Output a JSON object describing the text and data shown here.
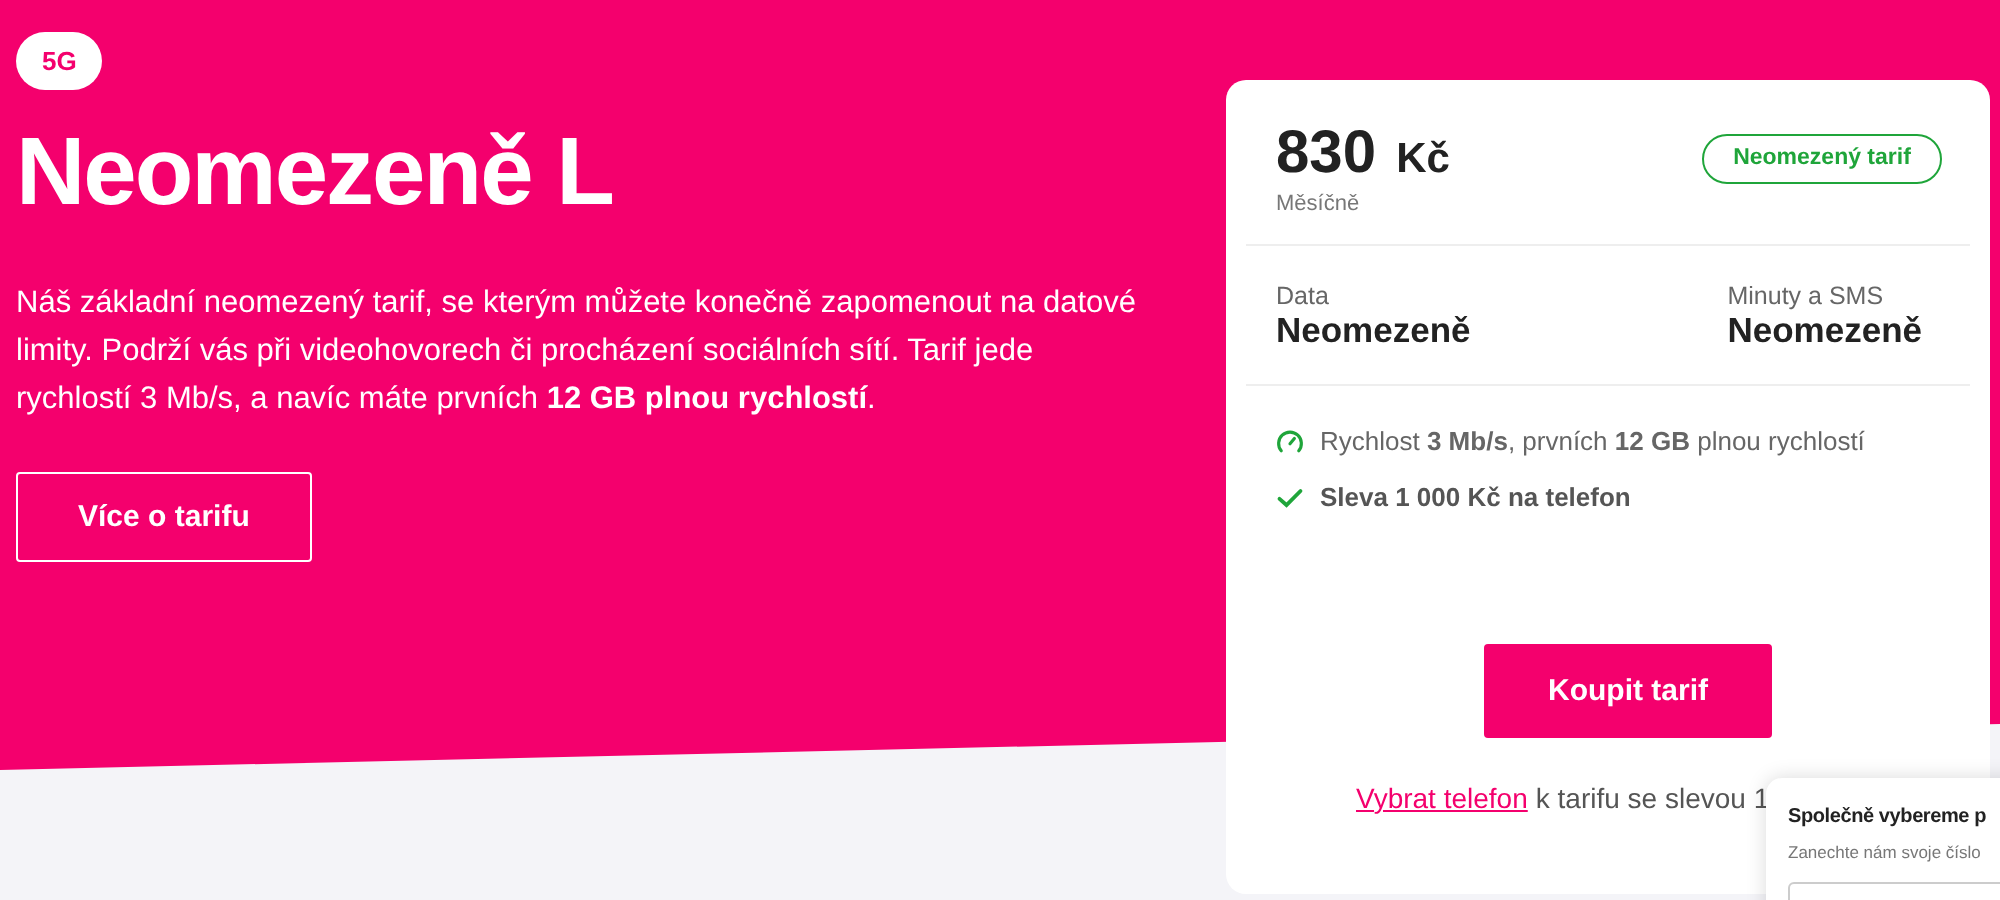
{
  "hero": {
    "badge": "5G",
    "title": "Neomezeně L",
    "description": "Náš základní neomezený tarif, se kterým můžete konečně zapomenout na datové limity. Podrží vás při videohovorech či procházení sociálních sítí. Tarif jede rychlostí 3 Mb/s, a navíc máte prvních **12 GB plnou rychlostí**.",
    "button": "Více o tarifu"
  },
  "card": {
    "price": "830",
    "currency": "Kč",
    "period": "Měsíčně",
    "tag": "Neomezený tarif",
    "specs": [
      {
        "label": "Data",
        "value": "Neomezeně"
      },
      {
        "label": "Minuty a SMS",
        "value": "Neomezeně"
      }
    ],
    "features": [
      {
        "kind": "speed",
        "text": "Rychlost **3 Mb/s**, prvních **12 GB** plnou rychlostí"
      },
      {
        "kind": "check",
        "text": "Sleva 1 000 Kč na telefon"
      }
    ],
    "buy_button": "Koupit tarif",
    "link": "Vybrat telefon",
    "link_suffix": "k tarifu se slevou 1"
  },
  "popup": {
    "title": "Společně vybereme p",
    "subtitle": "Zanechte nám svoje číslo"
  }
}
